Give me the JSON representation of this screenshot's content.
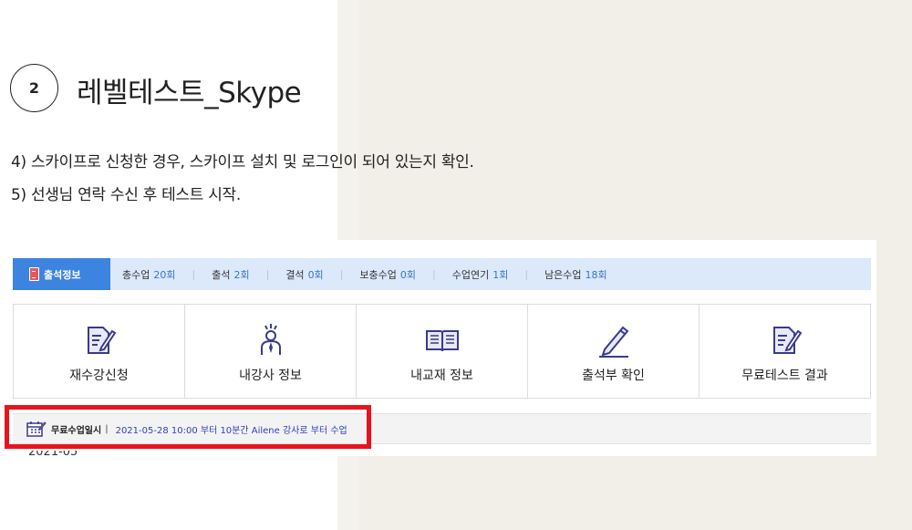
{
  "step": {
    "number": "2",
    "title": "레벨테스트_Skype"
  },
  "instructions": [
    "4) 스카이프로 신청한 경우, 스카이프 설치 및 로그인이 되어 있는지 확인.",
    "5) 선생님 연락 수신 후 테스트 시작."
  ],
  "stats": {
    "label": "출석정보",
    "items": [
      {
        "name": "총수업",
        "value": "20회"
      },
      {
        "name": "출석",
        "value": "2회"
      },
      {
        "name": "결석",
        "value": "0회"
      },
      {
        "name": "보충수업",
        "value": "0회"
      },
      {
        "name": "수업연기",
        "value": "1회"
      },
      {
        "name": "남은수업",
        "value": "18회"
      }
    ]
  },
  "tiles": [
    {
      "label": "재수강신청",
      "icon": "document-edit-icon"
    },
    {
      "label": "내강사 정보",
      "icon": "teacher-icon"
    },
    {
      "label": "내교재 정보",
      "icon": "book-icon"
    },
    {
      "label": "출석부 확인",
      "icon": "pen-icon"
    },
    {
      "label": "무료테스트 결과",
      "icon": "document-edit-icon"
    }
  ],
  "free_class": {
    "icon": "calendar-icon",
    "label": "무료수업일시",
    "separator": "|",
    "text": "2021-05-28  10:00 부터 10분간 Ailene 강사로 부터 수업"
  },
  "cut_text": "2021-05",
  "colors": {
    "accent_blue": "#3d83e0",
    "stats_bg": "#dce9fb",
    "value_blue": "#3a73cc",
    "highlight_red": "#e8141c",
    "free_text_blue": "#2d3fbd",
    "icon_navy": "#3b3a8c"
  }
}
